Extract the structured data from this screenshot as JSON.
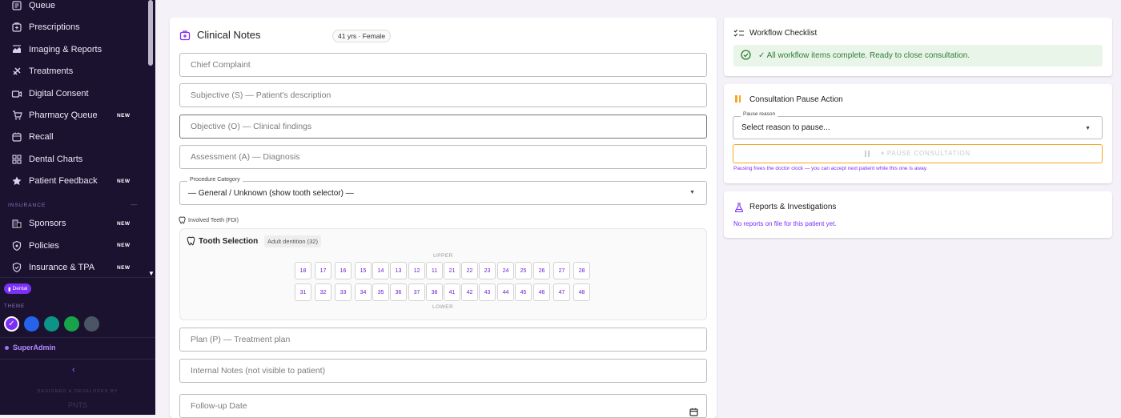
{
  "sidebar": {
    "items": [
      {
        "label": "Queue",
        "icon": "queue-icon",
        "badge": ""
      },
      {
        "label": "Prescriptions",
        "icon": "prescription-icon",
        "badge": ""
      },
      {
        "label": "Imaging & Reports",
        "icon": "imaging-icon",
        "badge": ""
      },
      {
        "label": "Treatments",
        "icon": "treatment-icon",
        "badge": ""
      },
      {
        "label": "Digital Consent",
        "icon": "consent-icon",
        "badge": ""
      },
      {
        "label": "Pharmacy Queue",
        "icon": "pharmacy-icon",
        "badge": "NEW"
      },
      {
        "label": "Recall",
        "icon": "recall-icon",
        "badge": ""
      },
      {
        "label": "Dental Charts",
        "icon": "grid-icon",
        "badge": ""
      },
      {
        "label": "Patient Feedback",
        "icon": "star-icon",
        "badge": "NEW"
      }
    ],
    "section_insurance": "INSURANCE",
    "section_dash": "—",
    "insurance_items": [
      {
        "label": "Sponsors",
        "icon": "building-icon",
        "badge": "NEW"
      },
      {
        "label": "Policies",
        "icon": "shield-icon",
        "badge": "NEW"
      },
      {
        "label": "Insurance & TPA",
        "icon": "shield-check-icon",
        "badge": "NEW"
      }
    ],
    "dental_badge": "Dental",
    "theme_label": "THEME",
    "theme_colors": [
      "#7b2ff7",
      "#2563eb",
      "#0d9488",
      "#16a34a",
      "#4b5563"
    ],
    "user": "SuperAdmin",
    "collapse": "‹",
    "designed_by": "DESIGNED & DEVELOPED BY",
    "logo_text": "PNTS"
  },
  "clinical": {
    "title": "Clinical Notes",
    "patient_badge": "41 yrs · Female",
    "chief_complaint": "Chief Complaint",
    "subjective": "Subjective (S) — Patient's description",
    "objective": "Objective (O) — Clinical findings",
    "assessment": "Assessment (A) — Diagnosis",
    "procedure_label": "Procedure Category",
    "procedure_value": "— General / Unknown (show tooth selector) —",
    "involved_teeth": "Involved Teeth (FDI)",
    "tooth_selection": "Tooth Selection",
    "dentition_badge": "Adult dentition (32)",
    "upper_label": "UPPER",
    "lower_label": "LOWER",
    "upper_teeth": [
      "18",
      "17",
      "16",
      "15",
      "14",
      "13",
      "12",
      "11",
      "21",
      "22",
      "23",
      "24",
      "25",
      "26",
      "27",
      "28"
    ],
    "lower_teeth": [
      "31",
      "32",
      "33",
      "34",
      "35",
      "36",
      "37",
      "38",
      "41",
      "42",
      "43",
      "44",
      "45",
      "46",
      "47",
      "48"
    ],
    "plan": "Plan (P) — Treatment plan",
    "internal_notes": "Internal Notes (not visible to patient)",
    "followup": "Follow-up Date"
  },
  "workflow": {
    "title": "Workflow Checklist",
    "message": "✓ All workflow items complete. Ready to close consultation."
  },
  "pause": {
    "title": "Consultation Pause Action",
    "reason_label": "Pause reason",
    "reason_placeholder": "Select reason to pause...",
    "button": "⏸ PAUSE CONSULTATION",
    "hint": "Pausing frees the doctor clock — you can accept next patient while this one is away."
  },
  "reports": {
    "title": "Reports & Investigations",
    "empty": "No reports on file for this patient yet."
  },
  "colors": {
    "accent": "#7b2ff7",
    "sidebar_bg": "#1b1230",
    "success": "#2e7d32",
    "warning": "#f5a623"
  }
}
